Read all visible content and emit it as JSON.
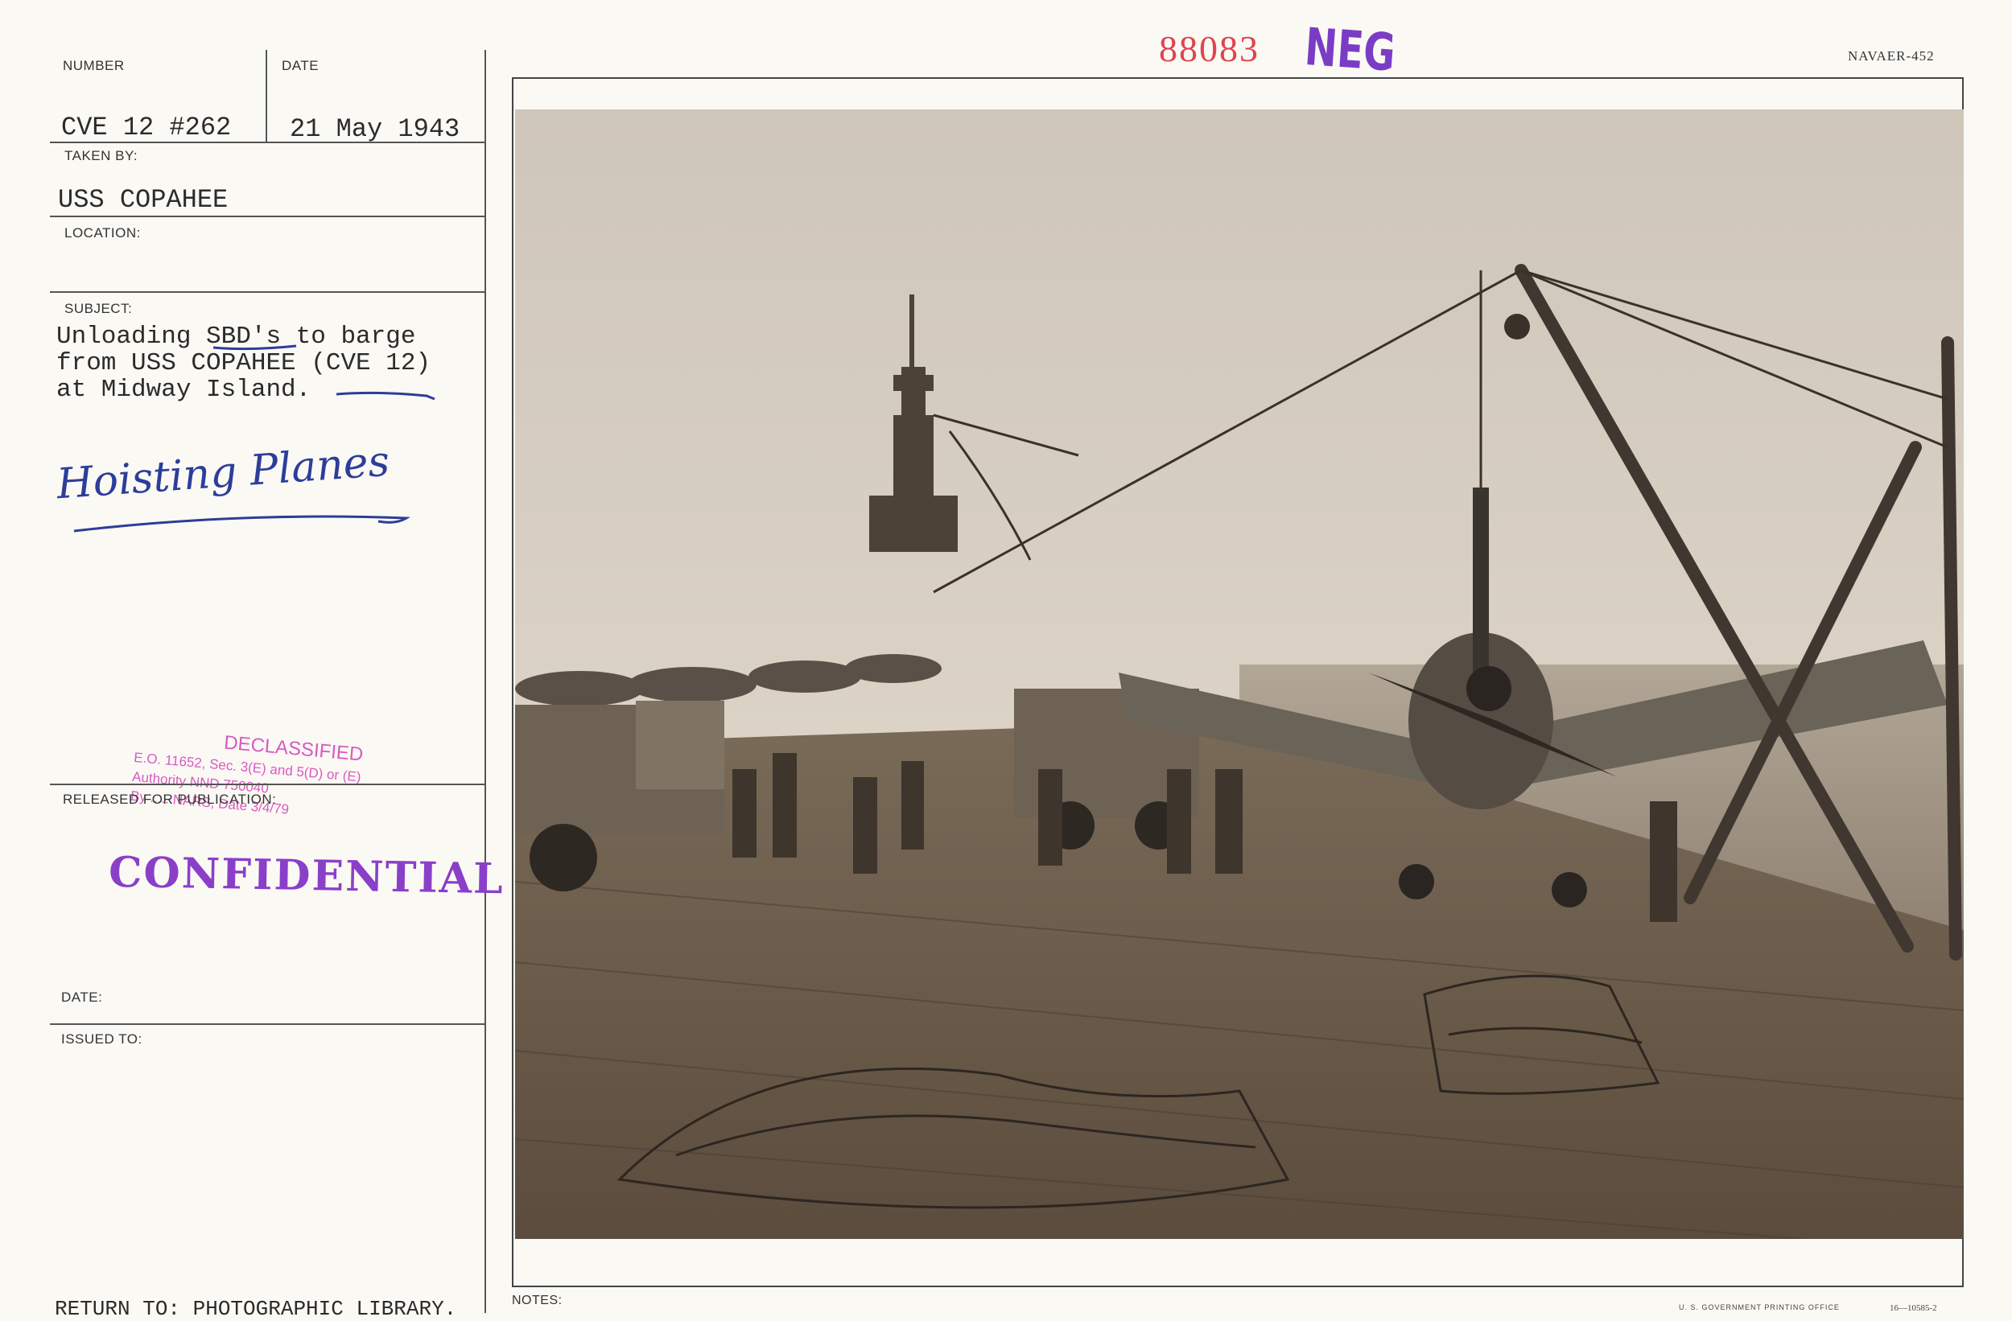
{
  "card": {
    "number_label": "NUMBER",
    "number_value": "CVE 12 #262",
    "date_label": "DATE",
    "date_value": "21 May 1943",
    "taken_by_label": "TAKEN BY:",
    "taken_by_value": "USS COPAHEE",
    "location_label": "LOCATION:",
    "subject_label": "SUBJECT:",
    "subject_lines": [
      "Unloading SBD's to barge",
      "from USS COPAHEE (CVE 12)",
      "at Midway Island."
    ],
    "handwritten_note": "Hoisting Planes",
    "released_label": "RELEASED FOR PUBLICATION:",
    "date2_label": "DATE:",
    "issued_to_label": "ISSUED TO:",
    "return_to": "RETURN TO: PHOTOGRAPHIC LIBRARY.",
    "notes_label": "NOTES:"
  },
  "stamps": {
    "negative_number": "88083",
    "neg": "NEG",
    "form_number": "NAVAER-452",
    "declassified_lines": [
      "DECLASSIFIED",
      "E.O. 11652, Sec. 3(E) and 5(D) or (E)",
      "Authority NND 750040",
      "By ..... NARS, Date 3/4/79"
    ],
    "confidential": "CONFIDENTIAL"
  },
  "footer": {
    "printer": "U. S. GOVERNMENT PRINTING OFFICE",
    "print_code": "16—10585-2"
  },
  "photo": {
    "description_icon": "carrier-deck-photo"
  }
}
